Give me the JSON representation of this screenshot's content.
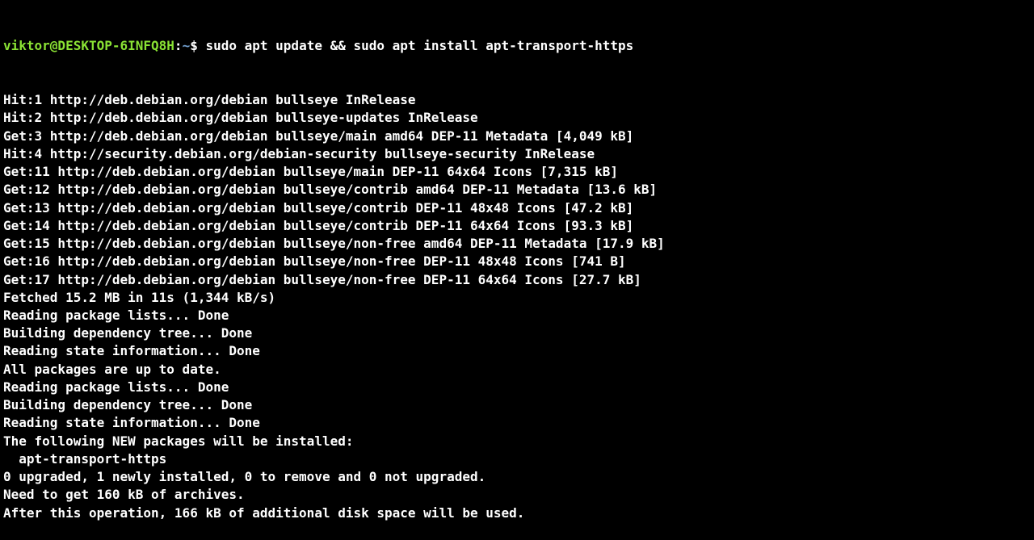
{
  "prompt": {
    "user_host": "viktor@DESKTOP-6INFQ8H",
    "colon": ":",
    "path": "~",
    "dollar": "$ ",
    "command": "sudo apt update && sudo apt install apt-transport-https"
  },
  "output_lines": [
    "Hit:1 http://deb.debian.org/debian bullseye InRelease",
    "Hit:2 http://deb.debian.org/debian bullseye-updates InRelease",
    "Get:3 http://deb.debian.org/debian bullseye/main amd64 DEP-11 Metadata [4,049 kB]",
    "Hit:4 http://security.debian.org/debian-security bullseye-security InRelease",
    "Get:11 http://deb.debian.org/debian bullseye/main DEP-11 64x64 Icons [7,315 kB]",
    "Get:12 http://deb.debian.org/debian bullseye/contrib amd64 DEP-11 Metadata [13.6 kB]",
    "Get:13 http://deb.debian.org/debian bullseye/contrib DEP-11 48x48 Icons [47.2 kB]",
    "Get:14 http://deb.debian.org/debian bullseye/contrib DEP-11 64x64 Icons [93.3 kB]",
    "Get:15 http://deb.debian.org/debian bullseye/non-free amd64 DEP-11 Metadata [17.9 kB]",
    "Get:16 http://deb.debian.org/debian bullseye/non-free DEP-11 48x48 Icons [741 B]",
    "Get:17 http://deb.debian.org/debian bullseye/non-free DEP-11 64x64 Icons [27.7 kB]",
    "Fetched 15.2 MB in 11s (1,344 kB/s)",
    "Reading package lists... Done",
    "Building dependency tree... Done",
    "Reading state information... Done",
    "All packages are up to date.",
    "Reading package lists... Done",
    "Building dependency tree... Done",
    "Reading state information... Done",
    "The following NEW packages will be installed:",
    "  apt-transport-https",
    "0 upgraded, 1 newly installed, 0 to remove and 0 not upgraded.",
    "Need to get 160 kB of archives.",
    "After this operation, 166 kB of additional disk space will be used."
  ]
}
